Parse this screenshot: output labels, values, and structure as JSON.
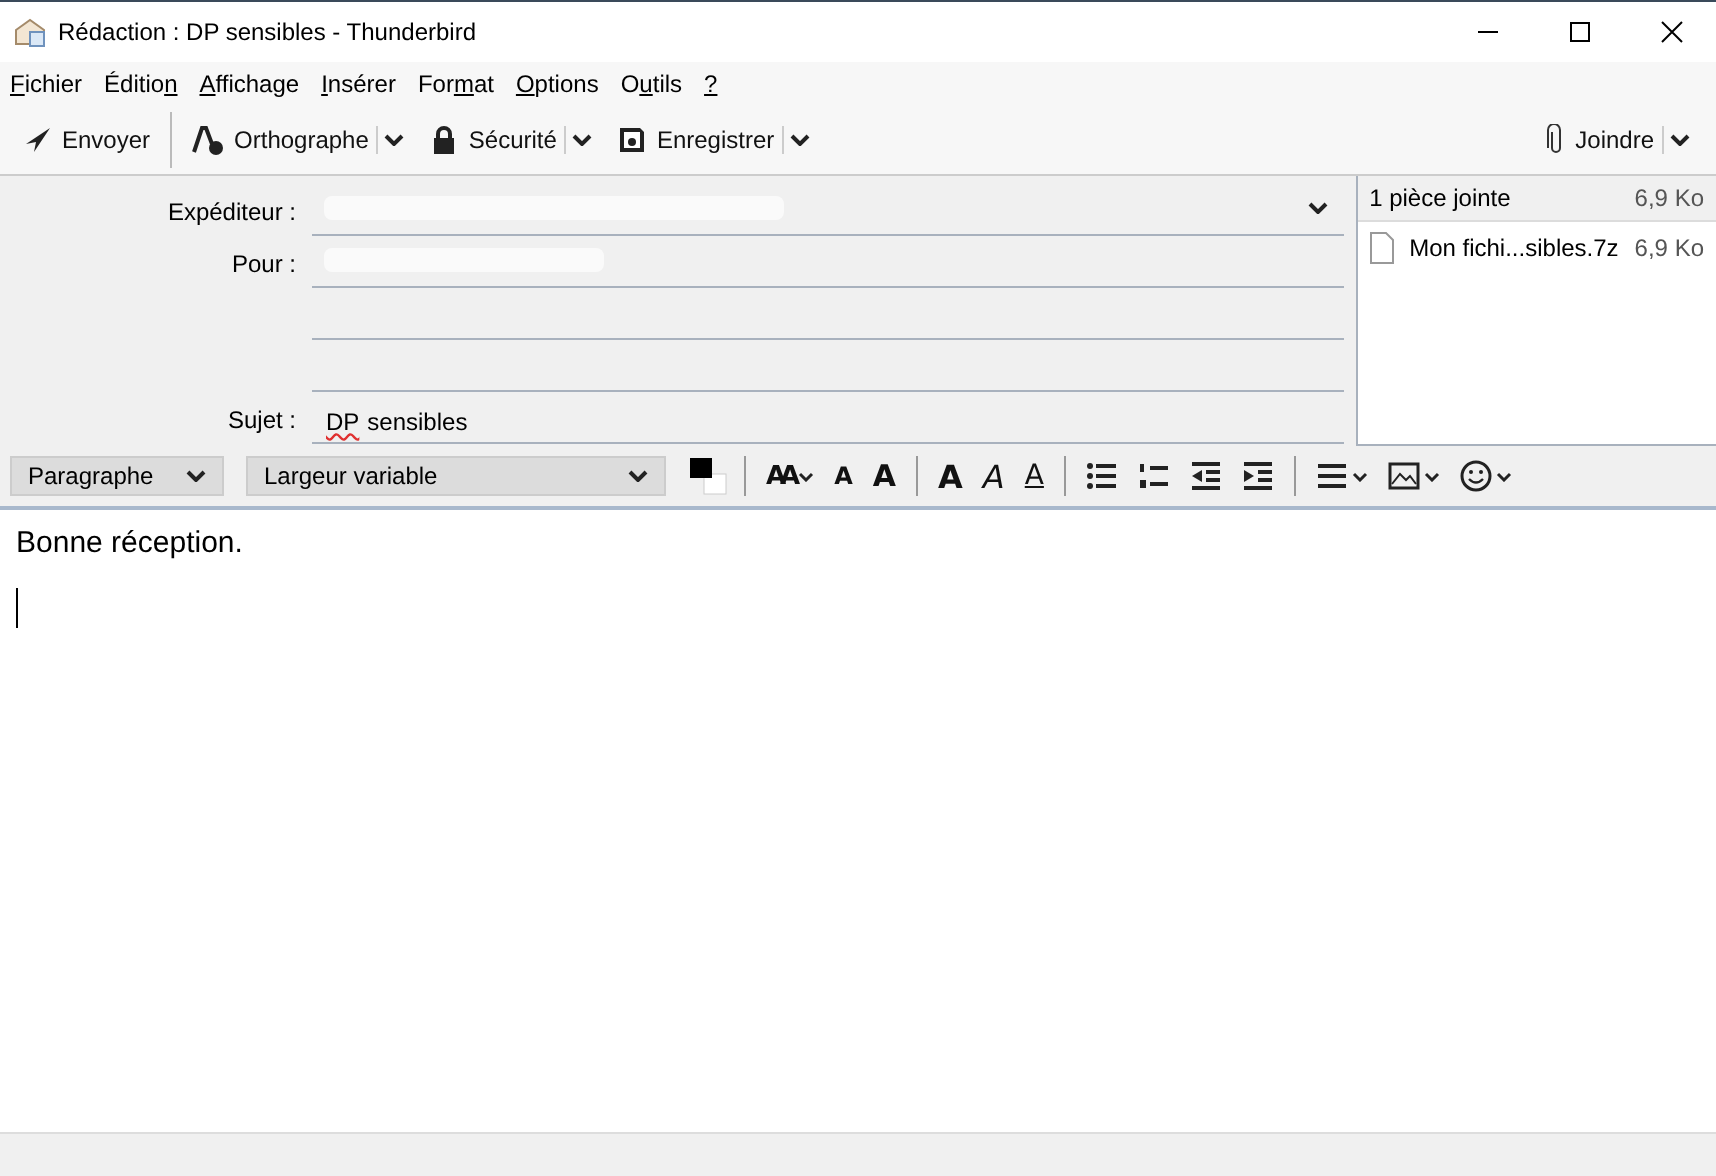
{
  "window": {
    "title": "Rédaction : DP sensibles - Thunderbird"
  },
  "menu": [
    {
      "key": "F",
      "rest": "ichier"
    },
    {
      "pre": "Éditio",
      "key": "n"
    },
    {
      "key": "A",
      "rest": "ffichage"
    },
    {
      "key": "I",
      "rest": "nsérer"
    },
    {
      "pre": "For",
      "key": "m",
      "rest": "at"
    },
    {
      "key": "O",
      "rest": "ptions"
    },
    {
      "pre": "O",
      "key": "u",
      "rest": "tils"
    },
    {
      "key": "?"
    }
  ],
  "toolbar": [
    {
      "kind": "send",
      "label": "Envoyer"
    },
    {
      "kind": "separator"
    },
    {
      "kind": "spell",
      "label": "Orthographe"
    },
    {
      "kind": "dropdown"
    },
    {
      "kind": "lock",
      "label": "Sécurité"
    },
    {
      "kind": "dropdown"
    },
    {
      "kind": "save",
      "label": "Enregistrer"
    },
    {
      "kind": "dropdown"
    }
  ],
  "attach_button": {
    "label": "Joindre"
  },
  "header": {
    "fields": [
      {
        "label": "Expéditeur :",
        "kind": "sender"
      },
      {
        "label": "Pour :",
        "kind": "recipient"
      },
      {
        "kind": "blank"
      },
      {
        "kind": "blank"
      },
      {
        "label": "Sujet :",
        "kind": "subject",
        "value_parts": [
          {
            "text": "DP",
            "misspelled": true
          },
          {
            "text": "sensibles",
            "misspelled": false
          }
        ]
      }
    ]
  },
  "attachments": {
    "summary": "1 pièce jointe",
    "total_size": "6,9 Ko",
    "items": [
      {
        "name": "Mon fichi...sibles.7z",
        "size": "6,9 Ko"
      }
    ]
  },
  "format_bar": {
    "paragraph": "Paragraphe",
    "font": "Largeur variable",
    "buttons": [
      {
        "kind": "color"
      },
      {
        "kind": "sep"
      },
      {
        "kind": "size",
        "glyph": "AA"
      },
      {
        "kind": "smaller",
        "glyph": "A"
      },
      {
        "kind": "bigger",
        "glyph": "A"
      },
      {
        "kind": "sep"
      },
      {
        "kind": "bold",
        "glyph": "A"
      },
      {
        "kind": "italic",
        "glyph": "A"
      },
      {
        "kind": "underline",
        "glyph": "A"
      },
      {
        "kind": "sep"
      },
      {
        "kind": "bullets"
      },
      {
        "kind": "numbers"
      },
      {
        "kind": "outdent"
      },
      {
        "kind": "indent"
      },
      {
        "kind": "sep"
      },
      {
        "kind": "align"
      },
      {
        "kind": "image"
      },
      {
        "kind": "smiley"
      }
    ]
  },
  "body": {
    "text": "Bonne réception."
  }
}
